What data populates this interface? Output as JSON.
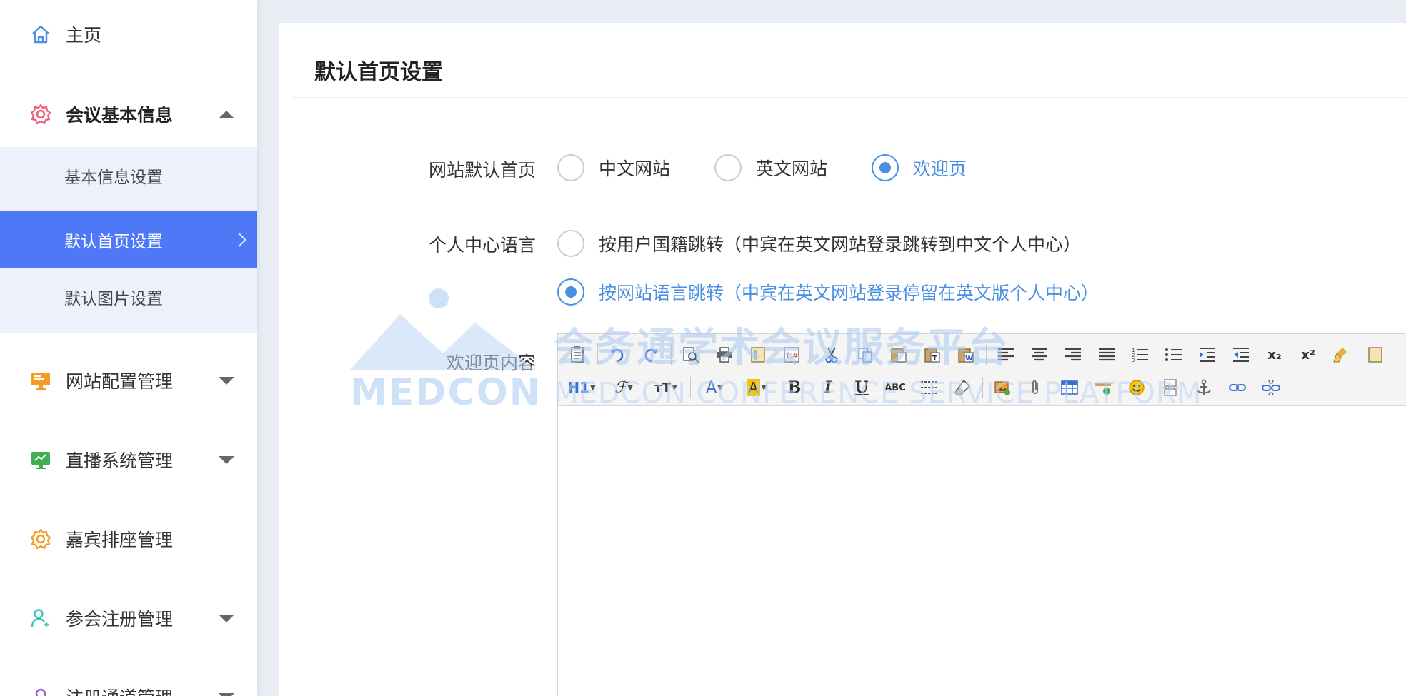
{
  "sidebar": {
    "home": "主页",
    "meeting_info": "会议基本信息",
    "sub_items": [
      "基本信息设置",
      "默认首页设置",
      "默认图片设置"
    ],
    "website_config": "网站配置管理",
    "live_system": "直播系统管理",
    "guest_seating": "嘉宾排座管理",
    "registration": "参会注册管理",
    "cut_item": "注册通道管理"
  },
  "panel": {
    "title": "默认首页设置",
    "default_home": {
      "label": "网站默认首页",
      "options": [
        "中文网站",
        "英文网站",
        "欢迎页"
      ],
      "selected": "欢迎页"
    },
    "personal_lang": {
      "label": "个人中心语言",
      "options": [
        "按用户国籍跳转（中宾在英文网站登录跳转到中文个人中心）",
        "按网站语言跳转（中宾在英文网站登录停留在英文版个人中心）"
      ],
      "selected": "按网站语言跳转（中宾在英文网站登录停留在英文版个人中心）"
    },
    "welcome_content": {
      "label": "欢迎页内容"
    }
  },
  "toolbar": {
    "row2_text": {
      "heading": "H1",
      "bold": "B",
      "italic": "I",
      "underline": "U",
      "strike": "ABC",
      "fontcolor": "A",
      "bgcolor": "A",
      "subscript": "x₂",
      "superscript": "x²"
    }
  },
  "watermark": {
    "cn": "会务通学术会议服务平台",
    "logo": "MEDCON",
    "en": "MEDCON CONFERENCE SERVICE PLATFORM"
  },
  "colors": {
    "accent": "#4a90e2",
    "sidebar_active": "#4e78f5",
    "icon_pink": "#ef5a76",
    "icon_orange": "#f59a23",
    "icon_green": "#3fae55",
    "icon_teal": "#39c7c0"
  }
}
